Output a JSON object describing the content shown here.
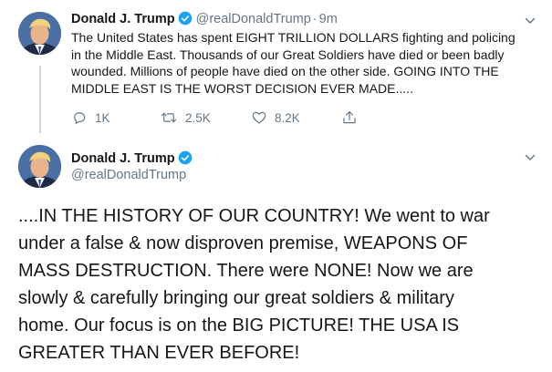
{
  "tweet1": {
    "author_name": "Donald J. Trump",
    "handle": "@realDonaldTrump",
    "separator": "·",
    "time": "9m",
    "text_lines": [
      "The United States has spent EIGHT TRILLION DOLLARS fighting and policing",
      "in the Middle East. Thousands of our Great Soldiers have died or been badly",
      "wounded. Millions of people have died on the other side. GOING INTO THE",
      "MIDDLE EAST IS THE WORST DECISION EVER MADE....."
    ],
    "reply_count": "1K",
    "retweet_count": "2.5K",
    "like_count": "8.2K"
  },
  "tweet2": {
    "author_name": "Donald J. Trump",
    "handle": "@realDonaldTrump",
    "text_lines": [
      "....IN THE HISTORY OF OUR COUNTRY! We went to war",
      "under a false & now disproven premise, WEAPONS OF",
      "MASS DESTRUCTION. There were NONE! Now we are",
      "slowly & carefully bringing our great soldiers & military",
      "home. Our focus is on the BIG PICTURE! THE USA IS",
      "GREATER THAN EVER BEFORE!"
    ]
  },
  "icons": {
    "verified": "verified-badge-icon",
    "caret": "chevron-down-icon",
    "reply": "reply-icon",
    "retweet": "retweet-icon",
    "like": "heart-icon",
    "share": "share-icon"
  },
  "colors": {
    "text_primary": "#14171a",
    "text_secondary": "#657786",
    "verified_blue": "#1da1f2",
    "thread_line": "#ccd6dd"
  }
}
